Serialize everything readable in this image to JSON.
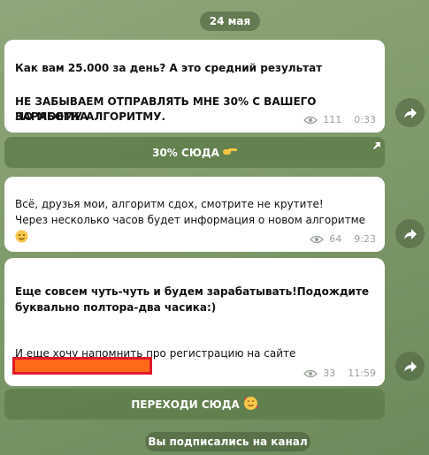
{
  "date_label": "24 мая",
  "subscribed_label": "Вы подписались на канал",
  "messages": [
    {
      "line1": "Как вам 25.000 за день? А это средний результат",
      "line2": "НЕ ЗАБЫВАЕМ ОТПРАВЛЯТЬ МНЕ 30% С ВАШЕГО ЗАРАБОТКА",
      "line3": "ПО МОЕМУ АЛГОРИТМУ.",
      "views": "111",
      "time": "0:33"
    },
    {
      "line1": "Всё, друзья мои, алгоритм сдох, смотрите не крутите!",
      "line2": "Через несколько часов будет информация о новом алгоритме",
      "views": "64",
      "time": "9:23"
    },
    {
      "line1": "Еще совсем чуть-чуть и будем зарабатывать!Подождите",
      "line2": "буквально полтора-два часика:)",
      "line3": "И еще хочу напомнить про регистрацию на сайте",
      "views": "33",
      "time": "11:59"
    }
  ],
  "buttons": {
    "btn1_label": "30% СЮДА",
    "btn2_label": "ПЕРЕХОДИ СЮДА"
  },
  "icons": {
    "eye": "eye-icon",
    "share": "share-arrow-icon",
    "corner": "external-link-arrow-icon",
    "hand": "pointing-hand-emoji",
    "wink": "winking-face-emoji",
    "party": "smiling-face-hearts-emoji"
  }
}
